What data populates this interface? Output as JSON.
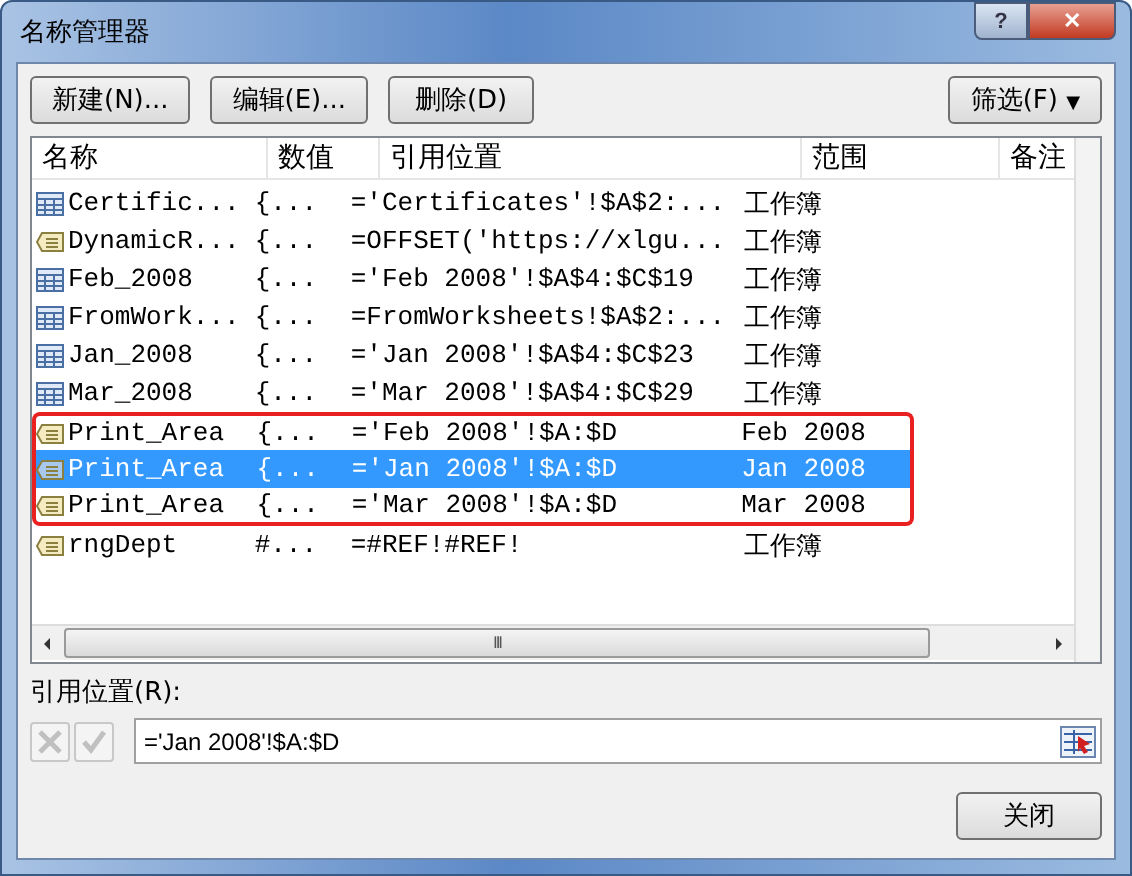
{
  "window": {
    "title": "名称管理器",
    "help": "?",
    "close": "✕"
  },
  "toolbar": {
    "buttons": [
      "新建(N)...",
      "编辑(E)...",
      "删除(D)"
    ],
    "filter": "筛选(F)",
    "filter_caret": "▼"
  },
  "table": {
    "columns": [
      "名称",
      "数值",
      "引用位置",
      "范围",
      "备注"
    ],
    "rows": [
      {
        "kind": "table",
        "name": "Certific...",
        "value": "{...",
        "refers_to": "='Certificates'!$A$2:...",
        "scope": "工作簿",
        "selected": false,
        "outlined": false
      },
      {
        "kind": "constant",
        "name": "DynamicR...",
        "value": "{...",
        "refers_to": "=OFFSET('https://xlgu...",
        "scope": "工作簿",
        "selected": false,
        "outlined": false
      },
      {
        "kind": "table",
        "name": "Feb_2008",
        "value": "{...",
        "refers_to": "='Feb 2008'!$A$4:$C$19",
        "scope": "工作簿",
        "selected": false,
        "outlined": false
      },
      {
        "kind": "table",
        "name": "FromWork...",
        "value": "{...",
        "refers_to": "=FromWorksheets!$A$2:...",
        "scope": "工作簿",
        "selected": false,
        "outlined": false
      },
      {
        "kind": "table",
        "name": "Jan_2008",
        "value": "{...",
        "refers_to": "='Jan 2008'!$A$4:$C$23",
        "scope": "工作簿",
        "selected": false,
        "outlined": false
      },
      {
        "kind": "table",
        "name": "Mar_2008",
        "value": "{...",
        "refers_to": "='Mar 2008'!$A$4:$C$29",
        "scope": "工作簿",
        "selected": false,
        "outlined": false
      },
      {
        "kind": "constant",
        "name": "Print_Area",
        "value": "{...",
        "refers_to": "='Feb 2008'!$A:$D",
        "scope": "Feb 2008",
        "selected": false,
        "outlined": true
      },
      {
        "kind": "constant",
        "name": "Print_Area",
        "value": "{...",
        "refers_to": "='Jan 2008'!$A:$D",
        "scope": "Jan 2008",
        "selected": true,
        "outlined": true
      },
      {
        "kind": "constant",
        "name": "Print_Area",
        "value": "{...",
        "refers_to": "='Mar 2008'!$A:$D",
        "scope": "Mar 2008",
        "selected": false,
        "outlined": true
      },
      {
        "kind": "constant",
        "name": "rngDept",
        "value": "#...",
        "refers_to": "=#REF!#REF!",
        "scope": "工作簿",
        "selected": false,
        "outlined": false
      }
    ],
    "scroll_grip": "III"
  },
  "refers_to": {
    "label": "引用位置(R):",
    "value": "='Jan 2008'!$A:$D"
  },
  "close_button": "关闭"
}
